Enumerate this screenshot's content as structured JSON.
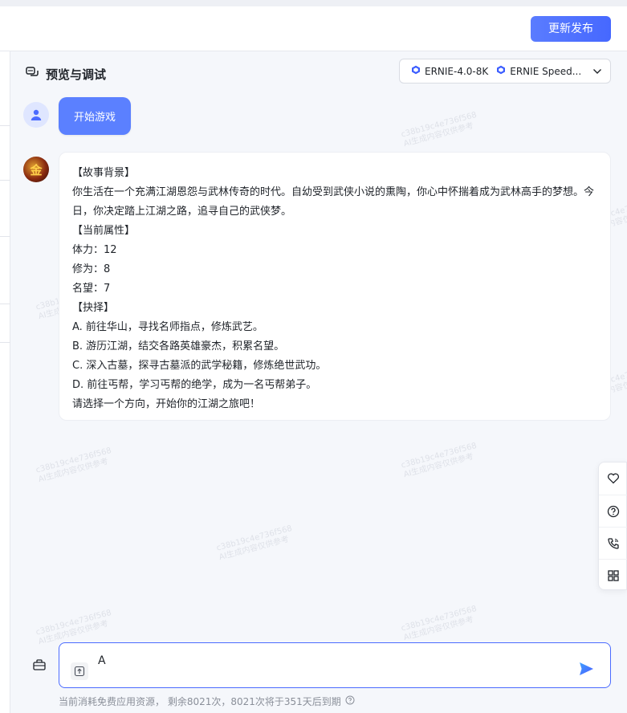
{
  "header": {
    "publish_label": "更新发布"
  },
  "panel": {
    "title": "预览与调试"
  },
  "models": {
    "primary": "ERNIE-4.0-8K",
    "secondary": "ERNIE Speed..."
  },
  "chat": {
    "user_message": "开始游戏",
    "bot_lines": [
      "【故事背景】",
      "你生活在一个充满江湖恩怨与武林传奇的时代。自幼受到武侠小说的熏陶，你心中怀揣着成为武林高手的梦想。今日，你决定踏上江湖之路，追寻自己的武侠梦。",
      "【当前属性】",
      "体力：12",
      "修为：8",
      "名望：7",
      "【抉择】",
      "A. 前往华山，寻找名师指点，修炼武艺。",
      "B. 游历江湖，结交各路英雄豪杰，积累名望。",
      "C. 深入古墓，探寻古墓派的武学秘籍，修炼绝世武功。",
      "D. 前往丐帮，学习丐帮的绝学，成为一名丐帮弟子。",
      "请选择一个方向，开始你的江湖之旅吧！"
    ],
    "bot_avatar_glyph": "金"
  },
  "watermark": {
    "line1": "c38b19c4e736f568",
    "line2": "AI生成内容仅供参考"
  },
  "input": {
    "value": "A"
  },
  "footer": {
    "note": "当前消耗免费应用资源， 剩余8021次，8021次将于351天后到期"
  },
  "icons": {
    "panel": "chat-bubbles-icon",
    "model": "cube-icon",
    "tools": [
      "heart-icon",
      "help-circle-icon",
      "phone-icon",
      "grid-icon"
    ],
    "toolbox": "toolbox-icon",
    "upload": "upload-icon",
    "send": "send-icon"
  },
  "colors": {
    "accent": "#4b6bff",
    "user_bubble": "#5b80ff"
  }
}
